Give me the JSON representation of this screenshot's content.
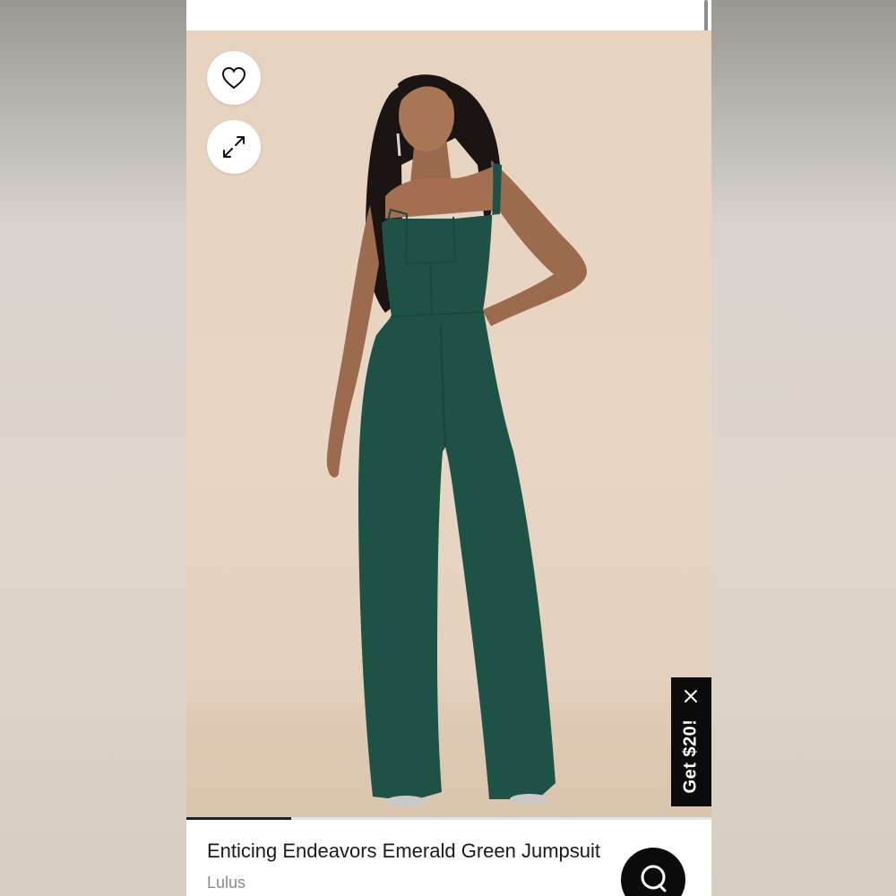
{
  "photo": {
    "progress_fraction": 0.2,
    "background_color": "#e6d3c0",
    "garment_color": "#1e5247"
  },
  "icons": {
    "favorite": "heart-outline-icon",
    "expand": "expand-arrows-icon",
    "close": "close-icon",
    "chat": "chat-bubble-icon"
  },
  "promo": {
    "label": "Get $20!"
  },
  "product": {
    "title": "Enticing Endeavors Emerald Green Jumpsuit",
    "brand": "Lulus"
  }
}
